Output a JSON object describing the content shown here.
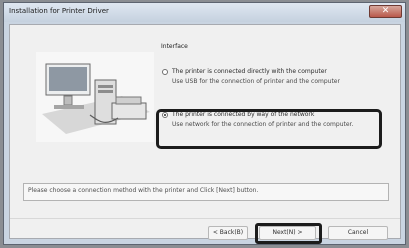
{
  "window": {
    "title": "Installation for Printer Driver"
  },
  "interface": {
    "group_title": "Interface",
    "option1": {
      "label": "The printer is connected directly with the computer",
      "desc": "Use USB for the connection of printer and the computer"
    },
    "option2": {
      "label": "The printer is connected by way of the network",
      "desc": "Use network for the connection of printer and the computer."
    }
  },
  "status": {
    "message": "Please choose a connection method with the printer and Click [Next] button."
  },
  "buttons": {
    "back": "< Back(B)",
    "next": "Next(N) >",
    "cancel": "Cancel"
  },
  "icons": {
    "close": "close-icon",
    "radio": "radio-button"
  },
  "colors": {
    "window_bg": "#c9d4e1",
    "client_bg": "#f0f0f0",
    "highlight": "#1c1c1c"
  }
}
